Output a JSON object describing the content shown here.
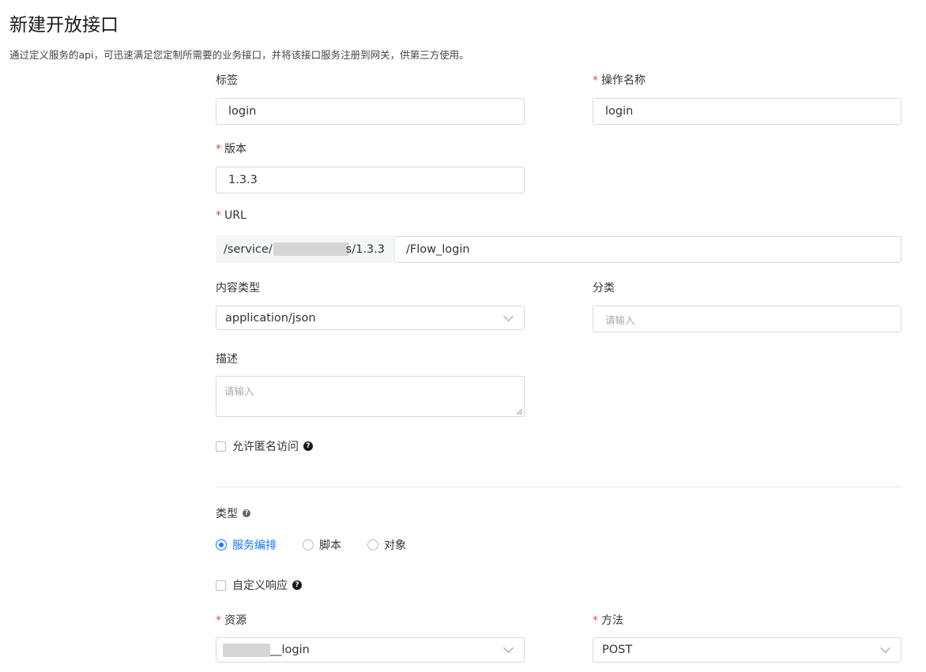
{
  "header": {
    "title": "新建开放接口",
    "subtitle": "通过定义服务的api，可迅速满足您定制所需要的业务接口，并将该接口服务注册到网关，供第三方使用。"
  },
  "form": {
    "tag": {
      "label": "标签",
      "value": "login"
    },
    "operation_name": {
      "required_mark": "*",
      "label": "操作名称",
      "value": "login"
    },
    "version": {
      "required_mark": "*",
      "label": "版本",
      "value": "1.3.3"
    },
    "url": {
      "required_mark": "*",
      "label": "URL",
      "prefix_start": "/service/(",
      "prefix_end": "s/1.3.3",
      "value": "/Flow_login"
    },
    "content_type": {
      "label": "内容类型",
      "value": "application/json"
    },
    "category": {
      "label": "分类",
      "placeholder": "请输入"
    },
    "description": {
      "label": "描述",
      "placeholder": "请输入"
    },
    "anonymous_access": {
      "label": "允许匿名访问",
      "checked": false
    },
    "type": {
      "label": "类型",
      "options": [
        {
          "label": "服务编排",
          "selected": true
        },
        {
          "label": "脚本",
          "selected": false
        },
        {
          "label": "对象",
          "selected": false
        }
      ]
    },
    "custom_response": {
      "label": "自定义响应",
      "checked": false
    },
    "resource": {
      "required_mark": "*",
      "label": "资源",
      "value_suffix": "__login"
    },
    "method": {
      "required_mark": "*",
      "label": "方法",
      "value": "POST"
    }
  },
  "colors": {
    "accent": "#1677ff",
    "required": "#e74c3c",
    "border": "#d9d9d9",
    "prefix_bg": "#f5f6f8"
  },
  "icons": {
    "help": "question-circle-icon",
    "select_arrow": "chevron-down-icon"
  }
}
